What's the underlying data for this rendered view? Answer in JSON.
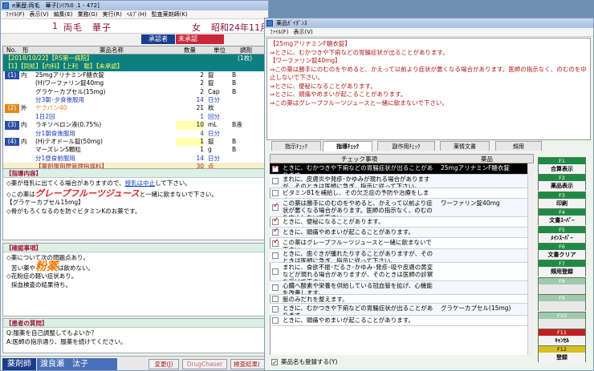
{
  "main": {
    "title": "e薬歴:両毛　華子[ｼﾘｱﾙ0 .1 - 472]",
    "menu": [
      "ﾌｧｲﾙ(F)",
      "表示(V)",
      "編集(E)",
      "業務(G)",
      "実行(R)",
      "ﾍﾙﾌﾟ(H)",
      "監査薬剤師(K)"
    ],
    "patient_id": "1",
    "patient_name": "両毛　華子",
    "sex": "女",
    "birth": "昭和24年11月",
    "approver_label": "承認者",
    "approver_value": "未承認",
    "header": {
      "no": "No.",
      "form": "形",
      "drug": "薬品名称",
      "qty": "数量",
      "unit": "単位",
      "adjust": "調剤"
    },
    "rows": [
      {
        "no": "【1】",
        "form": "",
        "drug": "【2018/10/22】【RS第一病院】",
        "qty": "",
        "unit": "",
        "adj": "(1枚)",
        "style": "band1"
      },
      {
        "no": "【1】",
        "form": "",
        "drug": "【1】【同処】【内科】【上利　聡】【未承認】",
        "qty": "",
        "unit": "",
        "adj": "",
        "style": "band2"
      },
      {
        "no": "(1)",
        "form": "内",
        "drug": "25mgアリナミンF糖衣錠",
        "qty": "2",
        "unit": "錠",
        "adj": "B",
        "style": "item",
        "nostyle": "blue"
      },
      {
        "no": "",
        "form": "",
        "drug": "(H)ワーファリン錠40mg",
        "qty": "2",
        "unit": "錠",
        "adj": "B",
        "style": "item"
      },
      {
        "no": "",
        "form": "",
        "drug": "グラケーカプセル(15mg)",
        "qty": "2",
        "unit": "Cap",
        "adj": "B",
        "style": "item"
      },
      {
        "no": "",
        "form": "",
        "drug": "分3朝･夕食後服用",
        "qty": "14",
        "unit": "日分",
        "adj": "",
        "style": "dose"
      },
      {
        "no": "(2)",
        "form": "外",
        "drug": "ヤクバン40",
        "qty": "21",
        "unit": "枚",
        "adj": "",
        "style": "item",
        "nostyle": "orange",
        "drugstyle": "orange"
      },
      {
        "no": "",
        "form": "",
        "drug": "1日2回",
        "qty": "1",
        "unit": "回分",
        "adj": "",
        "style": "dose"
      },
      {
        "no": "(3)",
        "form": "内",
        "drug": "ラキソベロン液(0.75%)",
        "qty": "10",
        "unit": "mL",
        "adj": "B液",
        "style": "item",
        "nostyle": "blue",
        "qtystyle": "hl"
      },
      {
        "no": "",
        "form": "",
        "drug": "分1朝食後服用",
        "qty": "4",
        "unit": "日分",
        "adj": "",
        "style": "dose"
      },
      {
        "no": "(4)",
        "form": "内",
        "drug": "(H)テオドール錠(50mg)",
        "qty": "1",
        "unit": "錠",
        "adj": "B",
        "style": "item",
        "nostyle": "blue",
        "qtystyle": "hl"
      },
      {
        "no": "",
        "form": "",
        "drug": "マーズレンS顆粒",
        "qty": "1",
        "unit": "g",
        "adj": "B",
        "style": "item"
      },
      {
        "no": "",
        "form": "",
        "drug": "分1昼食前服用",
        "qty": "14",
        "unit": "日分",
        "adj": "",
        "style": "dose"
      },
      {
        "no": "",
        "form": "",
        "drug": "【薬剤服用歴管理指導料】",
        "qty": "30",
        "unit": "点",
        "adj": "",
        "style": "fee"
      }
    ],
    "guidance_title": "【指導内容】",
    "guidance_l1a": "◇薬が母乳に出てくる場合がありますので、",
    "guidance_l1b": "授乳は中止",
    "guidance_l1c": "して下さい。",
    "guidance_l2a": "◇この薬は",
    "guidance_l2b": "グレープフルーツジュース",
    "guidance_l2c": "と一緒に飲まないで下さい。",
    "guidance_l3": "【グラケーカプセル15mg】",
    "guidance_l4": "◇骨がもろくなるのを防ぐビタミンKのお薬です。",
    "confirm_title": "【確認事項】",
    "confirm_l1": "◇薬について次の問題点あり。",
    "confirm_l2a": "苦い薬や",
    "confirm_l2b": "粉薬",
    "confirm_l2c": "は飲めない。",
    "confirm_l3": "◇花粉症の軽い症状あり。",
    "confirm_l4": "採血検査の結果待ち。",
    "question_title": "【患者の質問】",
    "question_l1": "Q:服薬を自己調整してもよいか？",
    "question_l2": "A:医師の指示通り、服薬を続けてください。",
    "footer_pharm": "薬剤師",
    "footer_name": "渡良瀬　汰子",
    "footer_change": "変更(J)",
    "footer_dc": "DrugChaser",
    "footer_check": "検査結果("
  },
  "guide": {
    "title": "薬品ｶﾞｲﾀﾞﾝｽ",
    "menu": [
      "ﾌｧｲﾙ(F)",
      "表示(V)"
    ],
    "text": [
      "【25mgアリナミンF糖衣錠】",
      "⇒とさに、むかつきや下痢などの胃腸症状が出ることがあります。",
      "【ワーファリン錠40mg】",
      "⇒この薬は勝手にのむのをやめると、かえって以前より症状が悪くなる場合があります。医師の指示なく、のむのを中止しないで下さい。",
      "⇒とさに、便秘になることがあります。",
      "⇒とさに、頭痛やめまいが起こることがあります。",
      "⇒この薬はグレープフルーツジュースと一緒に飲まないで下さい。"
    ],
    "tabs": [
      "指示ﾁｪｯｸ",
      "指導ﾁｪｯｸ",
      "副作用ﾁｪｯｸ",
      "薬情文書",
      "頻用"
    ],
    "col_check": "チェック事項",
    "col_drug": "薬品",
    "checks": [
      {
        "text": "ときに、むかつきや下痢などの胃腸症状が出ることがあります。",
        "drug": "25mgアリナミンF糖衣錠",
        "checked": true,
        "sel": true
      },
      {
        "text": "まれに、皮膚炎や発疹･かゆみが現れる場合がありますが、そのときは医師に急ぎ、指示に従って下さい。",
        "drug": "",
        "checked": false
      },
      {
        "text": "ビタミンB1を補給し、その欠乏症の予防や治療をします。",
        "drug": "",
        "checked": false
      },
      {
        "text": "この薬は勝手にのむのをやめると、かえって以前より症状が悪くなる場合があります。医師の指示なく、のむのを中止しないで下さい。",
        "drug": "ワーファリン錠40mg",
        "checked": true
      },
      {
        "text": "ときに、便秘になることがあります。",
        "drug": "",
        "checked": true
      },
      {
        "text": "ときに、頭痛やめまいが起こることがあります。",
        "drug": "",
        "checked": true
      },
      {
        "text": "この薬はグレープフルーツジュースと一緒に飲まないで下さい。",
        "drug": "",
        "checked": true
      },
      {
        "text": "ときに、歯ぐきが腫れたりすることがありますが、そのときは医師に急ぎ、指示に従って下さい。",
        "drug": "",
        "checked": false
      },
      {
        "text": "まれに、食欲不振･だるさ･かゆみ･発疹･吸や皮膚の黄変などが現れる場合がありますが、そのときは医師の診察を受けて下さい。",
        "drug": "",
        "checked": false
      },
      {
        "text": "心臓へ酸素や栄養を供給している冠血管を拡げ、心機能を改善します。",
        "drug": "",
        "checked": false
      },
      {
        "text": "脈のみだれを整えます。",
        "drug": "",
        "checked": false
      },
      {
        "text": "ときに、むかつきや下痢などの胃腸症状が出ることがあります。",
        "drug": "グラケーカプセル(15mg)",
        "checked": false
      },
      {
        "text": "ときに、頭痛やめまいが起こることがあります。",
        "drug": "",
        "checked": false
      }
    ],
    "register_drug": "薬品名も登録する(Y)",
    "fbuttons": [
      {
        "key": "F1",
        "label": "合算表示",
        "enabled": true
      },
      {
        "key": "F2",
        "label": "薬品表示",
        "enabled": true
      },
      {
        "key": "F3",
        "label": "印刷",
        "enabled": true
      },
      {
        "key": "F4",
        "label": "文書ｽｰﾊﾟｰ",
        "enabled": true
      },
      {
        "key": "F5",
        "label": "ﾒｲﾝｽｰﾊﾟｰ",
        "enabled": true
      },
      {
        "key": "F6",
        "label": "文書クリア",
        "enabled": true
      },
      {
        "key": "F7",
        "label": "頻用登録",
        "enabled": true
      },
      {
        "key": "F8",
        "label": "",
        "enabled": false
      },
      {
        "key": "F9",
        "label": "",
        "enabled": false
      },
      {
        "key": "F10",
        "label": "",
        "enabled": false
      },
      {
        "key": "F11",
        "label": "ｷｬﾝｾﾙ",
        "enabled": true
      },
      {
        "key": "F12",
        "label": "登録",
        "enabled": true
      }
    ]
  },
  "colors": {
    "accent_green": "#1e8a46",
    "band_title": "#0a2a7a",
    "section_title": "#a01030",
    "selected_row": "#000000"
  }
}
